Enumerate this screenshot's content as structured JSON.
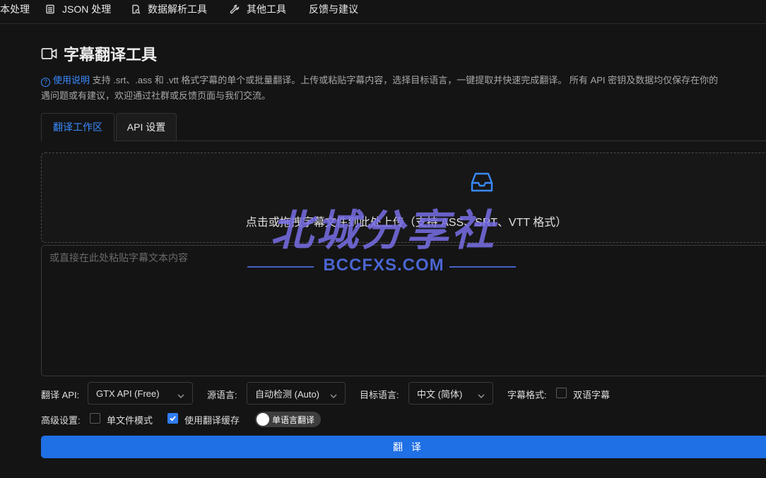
{
  "nav": {
    "items": [
      {
        "label": "本处理",
        "icon": "none"
      },
      {
        "label": "JSON 处理",
        "icon": "list-icon"
      },
      {
        "label": "数据解析工具",
        "icon": "search-doc-icon"
      },
      {
        "label": "其他工具",
        "icon": "wrench-icon"
      },
      {
        "label": "反馈与建议",
        "icon": "none"
      }
    ]
  },
  "page": {
    "title": "字幕翻译工具",
    "help_link": "使用说明",
    "help_text_1": " 支持 .srt、.ass 和 .vtt 格式字幕的单个或批量翻译。上传或粘贴字幕内容，选择目标语言，一键提取并快速完成翻译。 所有 API 密钥及数据均仅保存在你的",
    "help_text_2": "遇问题或有建议，欢迎通过社群或反馈页面与我们交流。"
  },
  "tabs": [
    {
      "label": "翻译工作区",
      "active": true
    },
    {
      "label": "API 设置",
      "active": false
    }
  ],
  "upload": {
    "text": "点击或拖拽字幕文件到此处上传（支持 ASS、SRT、VTT 格式）"
  },
  "paste": {
    "placeholder": "或直接在此处粘贴字幕文本内容"
  },
  "controls": {
    "api_label": "翻译 API:",
    "api_value": "GTX API (Free)",
    "source_label": "源语言:",
    "source_value": "自动检测 (Auto)",
    "target_label": "目标语言:",
    "target_value": "中文 (简体)",
    "format_label": "字幕格式:",
    "bilingual_label": "双语字幕",
    "bilingual_checked": false,
    "advanced_label": "高级设置:",
    "single_file_label": "单文件模式",
    "single_file_checked": false,
    "cache_label": "使用翻译缓存",
    "cache_checked": true,
    "mono_switch_label": "单语言翻译"
  },
  "actions": {
    "translate_label": "翻 译"
  },
  "watermark": {
    "main": "北城分享社",
    "sub": "BCCFXS.COM"
  },
  "colors": {
    "accent": "#3a8bff",
    "button": "#1f6fe5",
    "background": "#141414"
  }
}
